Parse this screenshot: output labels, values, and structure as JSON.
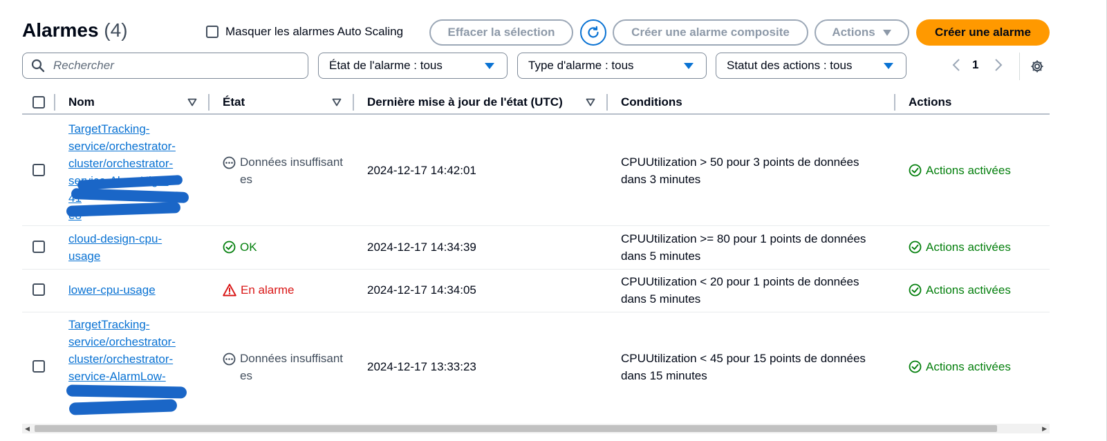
{
  "header": {
    "title": "Alarmes",
    "count": "(4)",
    "hide_autoscaling_label": "Masquer les alarmes Auto Scaling",
    "clear_selection_label": "Effacer la sélection",
    "create_composite_label": "Créer une alarme composite",
    "actions_label": "Actions",
    "create_alarm_label": "Créer une alarme"
  },
  "filters": {
    "search_placeholder": "Rechercher",
    "alarm_state": "État de l'alarme : tous",
    "alarm_type": "Type d'alarme : tous",
    "actions_status": "Statut des actions : tous"
  },
  "pagination": {
    "current_page": "1"
  },
  "table": {
    "columns": {
      "name": "Nom",
      "state": "État",
      "last_update": "Dernière mise à jour de l'état (UTC)",
      "conditions": "Conditions",
      "actions": "Actions"
    },
    "rows": [
      {
        "name_lines": [
          "TargetTracking-",
          "service/orchestrator-",
          "cluster/orchestrator-",
          "service-AlarmHigh-",
          "41",
          "e8"
        ],
        "state": "Données insuffisantes",
        "state_type": "insufficient",
        "last_update": "2024-12-17 14:42:01",
        "conditions": "CPUUtilization > 50 pour 3 points de données dans 3 minutes",
        "actions": "Actions activées"
      },
      {
        "name_lines": [
          "cloud-design-cpu-",
          "usage"
        ],
        "state": "OK",
        "state_type": "ok",
        "last_update": "2024-12-17 14:34:39",
        "conditions": "CPUUtilization >= 80 pour 1 points de données dans 5 minutes",
        "actions": "Actions activées"
      },
      {
        "name_lines": [
          "lower-cpu-usage"
        ],
        "state": "En alarme",
        "state_type": "alarm",
        "last_update": "2024-12-17 14:34:05",
        "conditions": "CPUUtilization < 20 pour 1 points de données dans 5 minutes",
        "actions": "Actions activées"
      },
      {
        "name_lines": [
          "TargetTracking-",
          "service/orchestrator-",
          "cluster/orchestrator-",
          "service-AlarmLow-",
          "",
          ""
        ],
        "state": "Données insuffisantes",
        "state_type": "insufficient",
        "last_update": "2024-12-17 13:33:23",
        "conditions": "CPUUtilization < 45 pour 15 points de données dans 15 minutes",
        "actions": "Actions activées"
      }
    ]
  },
  "colors": {
    "link": "#0972d3",
    "primary": "#ff9900",
    "ok": "#037f0c",
    "alarm": "#d91515",
    "redaction": "#1a66c7"
  }
}
